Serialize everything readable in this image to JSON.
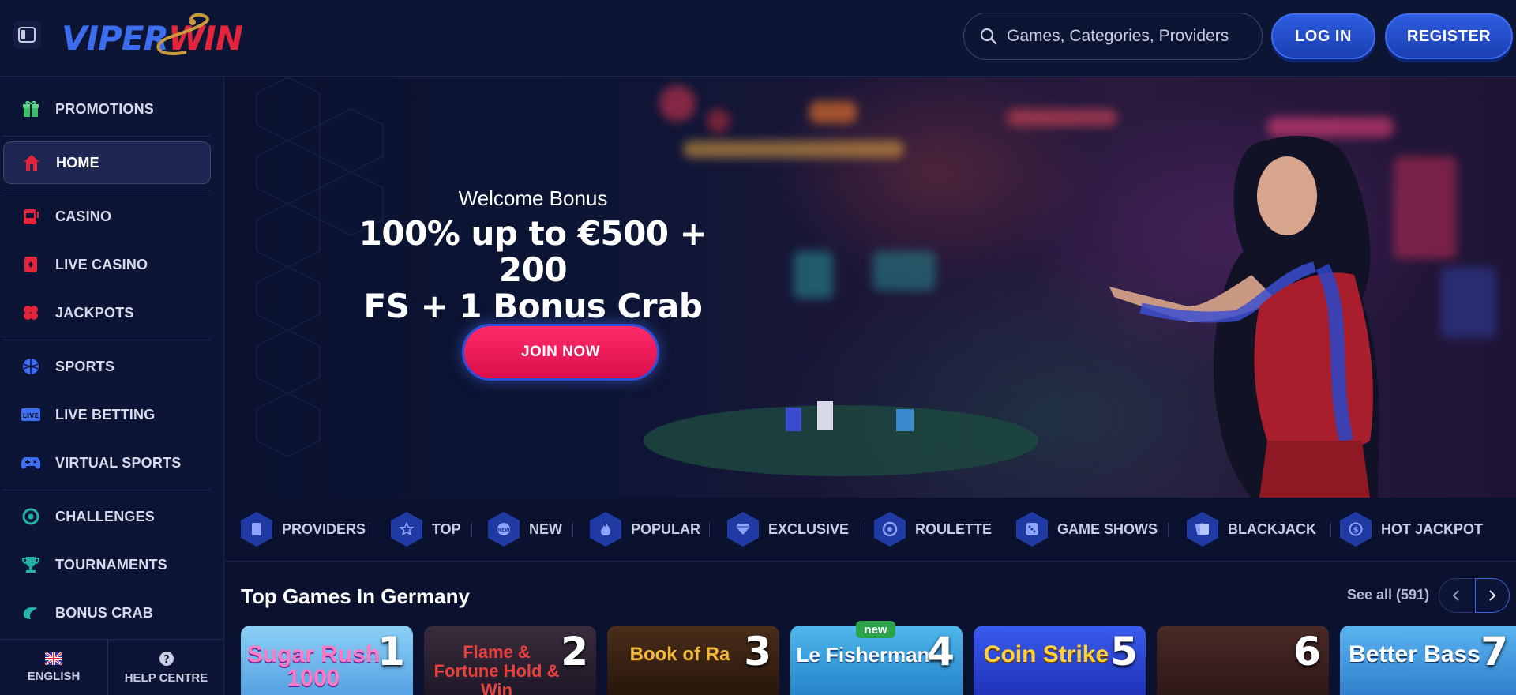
{
  "header": {
    "logo_text_left": "VIPER",
    "logo_text_right": "WIN",
    "search_placeholder": "Games, Categories, Providers",
    "login_label": "LOG IN",
    "register_label": "REGISTER"
  },
  "sidebar": {
    "items": [
      {
        "label": "PROMOTIONS",
        "icon": "gift-icon",
        "color": "#3bbf6a"
      },
      {
        "label": "HOME",
        "icon": "home-icon",
        "color": "#e2243c",
        "active": true
      },
      {
        "label": "CASINO",
        "icon": "slot-machine-icon",
        "color": "#e2243c"
      },
      {
        "label": "LIVE CASINO",
        "icon": "playing-card-icon",
        "color": "#e2243c"
      },
      {
        "label": "JACKPOTS",
        "icon": "clover-icon",
        "color": "#e2243c"
      },
      {
        "label": "SPORTS",
        "icon": "ball-icon",
        "color": "#3c6cf0"
      },
      {
        "label": "LIVE BETTING",
        "icon": "live-badge-icon",
        "color": "#3c6cf0"
      },
      {
        "label": "VIRTUAL SPORTS",
        "icon": "gamepad-icon",
        "color": "#3c6cf0"
      },
      {
        "label": "CHALLENGES",
        "icon": "target-icon",
        "color": "#22b3a8"
      },
      {
        "label": "TOURNAMENTS",
        "icon": "trophy-icon",
        "color": "#22b3a8"
      },
      {
        "label": "BONUS CRAB",
        "icon": "crab-icon",
        "color": "#22b3a8"
      }
    ],
    "footer": {
      "language_label": "ENGLISH",
      "help_label": "HELP CENTRE"
    }
  },
  "hero": {
    "kicker": "Welcome Bonus",
    "title_line1": "100% up to €500 + 200",
    "title_line2": "FS + 1 Bonus Crab",
    "cta_label": "JOIN NOW"
  },
  "categories": [
    {
      "label": "PROVIDERS",
      "icon": "providers-icon"
    },
    {
      "label": "TOP",
      "icon": "star-icon"
    },
    {
      "label": "NEW",
      "icon": "new-icon"
    },
    {
      "label": "POPULAR",
      "icon": "flame-icon"
    },
    {
      "label": "EXCLUSIVE",
      "icon": "diamond-icon"
    },
    {
      "label": "ROULETTE",
      "icon": "roulette-icon"
    },
    {
      "label": "GAME SHOWS",
      "icon": "dice-icon"
    },
    {
      "label": "BLACKJACK",
      "icon": "cards-icon"
    },
    {
      "label": "HOT JACKPOT",
      "icon": "jackpot-icon"
    }
  ],
  "top_games": {
    "title": "Top Games In Germany",
    "see_all_label": "See all (591)",
    "games": [
      {
        "rank": "1",
        "name": "Sugar Rush 1000",
        "bg": "#6fb6ea"
      },
      {
        "rank": "2",
        "name": "Flame & Fortune Hold & Win",
        "bg": "#2a1f2c"
      },
      {
        "rank": "3",
        "name": "Book of Ra",
        "bg": "#3b2414"
      },
      {
        "rank": "4",
        "name": "Le Fisherman",
        "bg": "#2e9ad6",
        "badge": "new"
      },
      {
        "rank": "5",
        "name": "Coin Strike",
        "bg": "#2a48d8"
      },
      {
        "rank": "6",
        "name": "",
        "bg": "#3b2220"
      },
      {
        "rank": "7",
        "name": "Better Bass",
        "bg": "#3e9ee0"
      }
    ]
  }
}
